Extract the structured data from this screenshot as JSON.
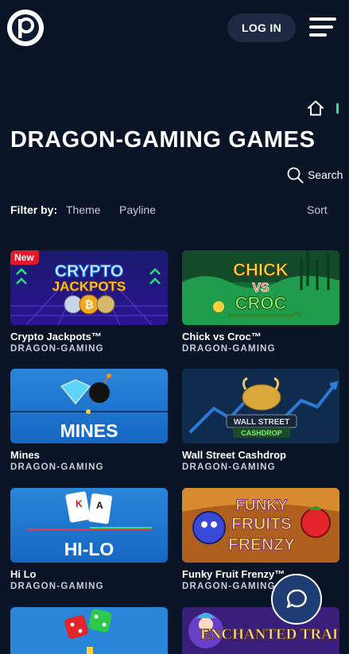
{
  "header": {
    "login_label": "LOG IN",
    "logo_letter": "p"
  },
  "page": {
    "title": "DRAGON-GAMING GAMES"
  },
  "search": {
    "label": "Search"
  },
  "filters": {
    "label": "Filter by:",
    "theme": "Theme",
    "payline": "Payline",
    "sort": "Sort"
  },
  "games": [
    {
      "name": "Crypto Jackpots™",
      "provider": "DRAGON-GAMING",
      "badge": "New",
      "art": "CRYPTO JACKPOTS"
    },
    {
      "name": "Chick vs Croc™",
      "provider": "DRAGON-GAMING",
      "art": "CHICK VS CROC"
    },
    {
      "name": "Mines",
      "provider": "DRAGON-GAMING",
      "art": "MINES"
    },
    {
      "name": "Wall Street Cashdrop",
      "provider": "DRAGON-GAMING",
      "art": "WALL STREET CASHDROP"
    },
    {
      "name": "Hi Lo",
      "provider": "DRAGON-GAMING",
      "art": "HI-LO"
    },
    {
      "name": "Funky Fruit Frenzy™",
      "provider": "DRAGON-GAMING",
      "art": "FUNKY FRUITS FRENZY"
    },
    {
      "name": "",
      "provider": "",
      "art": ""
    },
    {
      "name": "",
      "provider": "",
      "art": "ENCHANTED TRAIL"
    }
  ],
  "colors": {
    "background": "#091527",
    "accent": "#2ee08a",
    "badge": "#e3192b",
    "button": "#1e2a44"
  },
  "icons": {
    "home": "home-icon",
    "search": "search-icon",
    "menu": "hamburger-menu-icon",
    "chat": "chat-bubble-icon"
  }
}
